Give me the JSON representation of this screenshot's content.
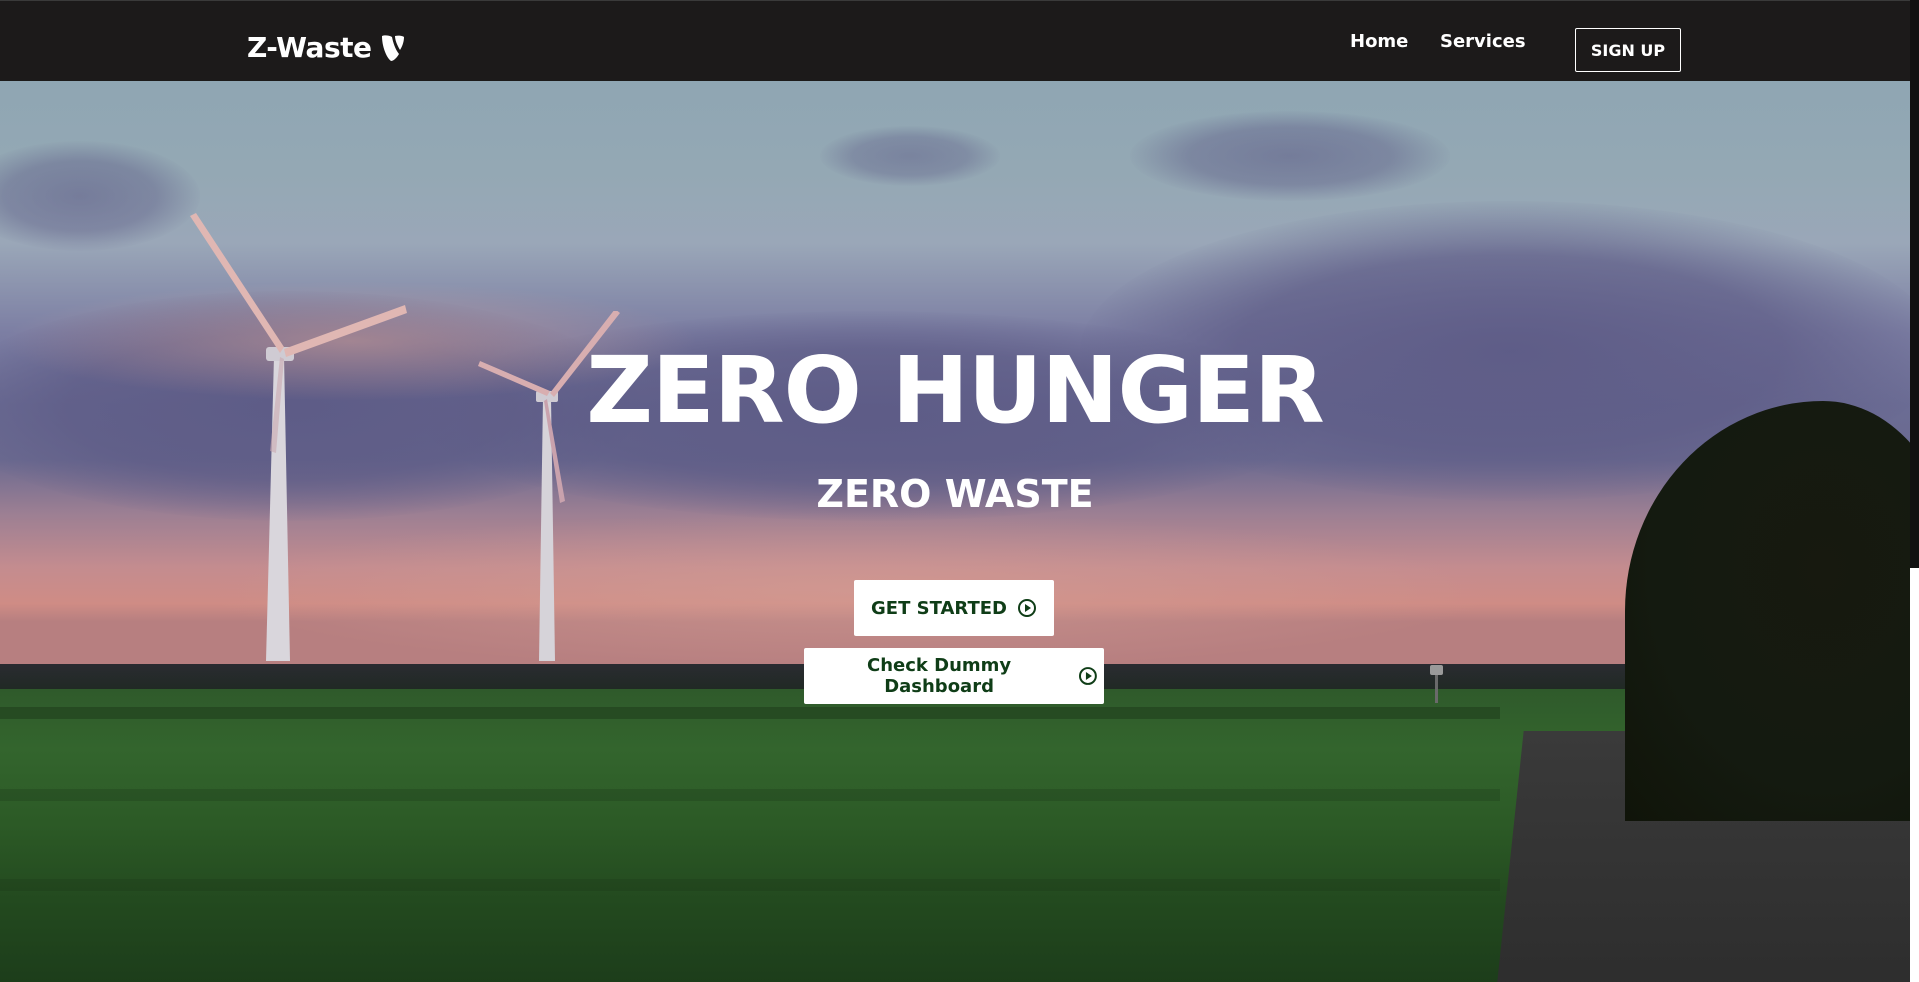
{
  "window": {
    "title": "Z-Waste"
  },
  "navbar": {
    "brand": "Z-Waste",
    "brand_icon": "typo3-shield-icon",
    "links": [
      {
        "label": "Home"
      },
      {
        "label": "Services"
      }
    ],
    "signup_label": "SIGN UP",
    "background_color": "#1c1a1a"
  },
  "hero": {
    "title": "ZERO HUNGER",
    "subtitle": "ZERO WASTE",
    "primary_button": {
      "label": "GET STARTED",
      "icon": "play-circle-icon"
    },
    "secondary_button": {
      "label": "Check Dummy Dashboard",
      "icon": "play-circle-icon"
    },
    "button_text_color": "#0f3d17",
    "background_image": "wind-turbines-sunset-landscape"
  }
}
